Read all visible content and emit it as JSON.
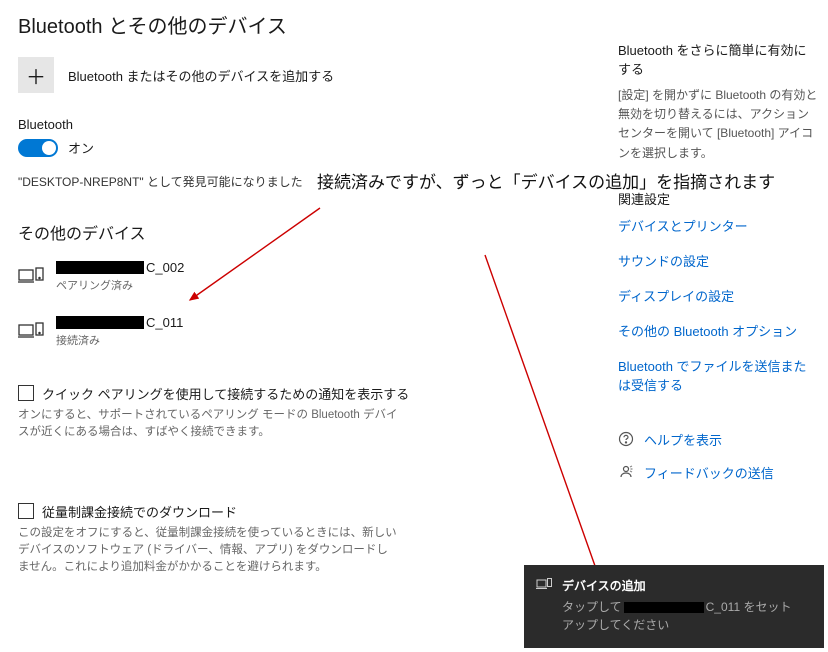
{
  "title": "Bluetooth とその他のデバイス",
  "add": {
    "label": "Bluetooth またはその他のデバイスを追加する"
  },
  "bt": {
    "section": "Bluetooth",
    "state": "オン",
    "discoverable": "\"DESKTOP-NREP8NT\" として発見可能になりました"
  },
  "other": {
    "heading": "その他のデバイス",
    "devices": [
      {
        "suffix": "C_002",
        "status": "ペアリング済み"
      },
      {
        "suffix": "C_011",
        "status": "接続済み"
      }
    ]
  },
  "quick": {
    "label": "クイック ペアリングを使用して接続するための通知を表示する",
    "desc": "オンにすると、サポートされているペアリング モードの Bluetooth デバイスが近くにある場合は、すばやく接続できます。"
  },
  "metered": {
    "label": "従量制課金接続でのダウンロード",
    "desc": "この設定をオフにすると、従量制課金接続を使っているときには、新しいデバイスのソフトウェア (ドライバー、情報、アプリ) をダウンロードしません。これにより追加料金がかかることを避けられます。"
  },
  "side": {
    "tip_title": "Bluetooth をさらに簡単に有効にする",
    "tip_desc": "[設定] を開かずに Bluetooth の有効と無効を切り替えるには、アクション センターを開いて [Bluetooth] アイコンを選択します。",
    "related_heading": "関連設定",
    "links": [
      "デバイスとプリンター",
      "サウンドの設定",
      "ディスプレイの設定",
      "その他の Bluetooth オプション",
      "Bluetooth でファイルを送信または受信する"
    ],
    "help": "ヘルプを表示",
    "feedback": "フィードバックの送信"
  },
  "annotation": "接続済みですが、ずっと「デバイスの追加」を指摘されます",
  "toast": {
    "title": "デバイスの追加",
    "pre": "タップして",
    "suffix": "C_011 をセット",
    "line2": "アップしてください"
  }
}
